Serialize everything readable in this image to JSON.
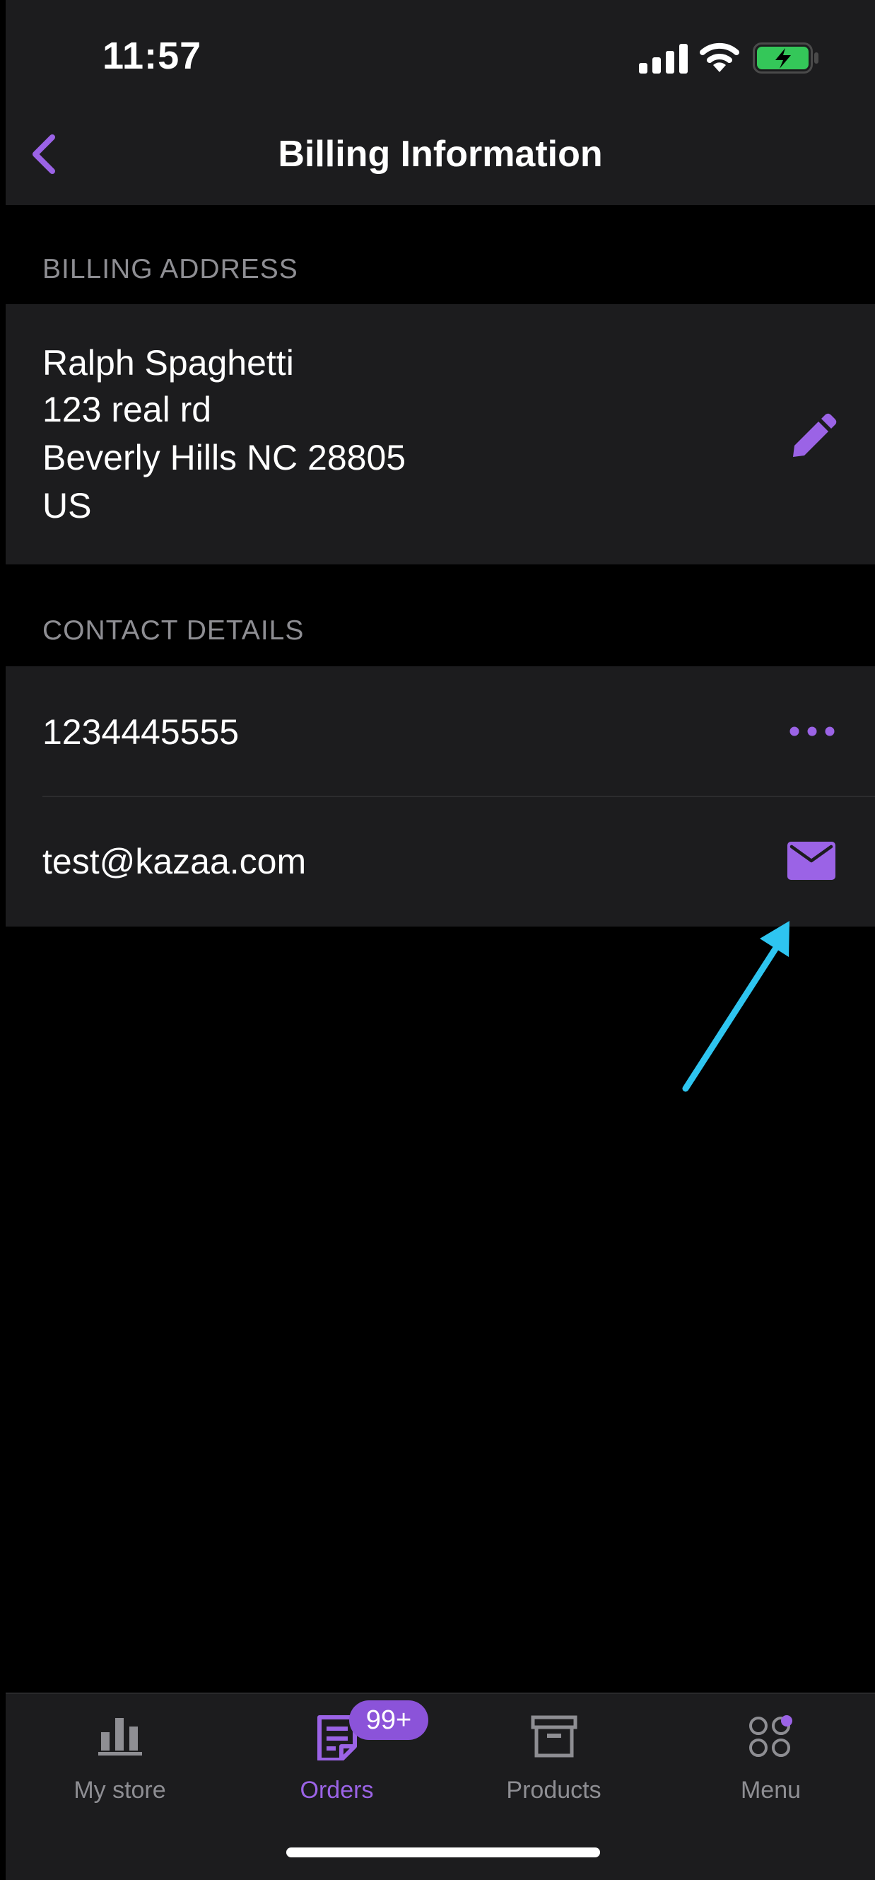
{
  "status_bar": {
    "time": "11:57"
  },
  "nav": {
    "title": "Billing Information",
    "back_icon": "chevron-left-icon"
  },
  "billing_address": {
    "header": "BILLING ADDRESS",
    "lines": [
      "Ralph Spaghetti",
      "123 real rd",
      "Beverly Hills NC 28805",
      "US"
    ],
    "action_icon": "pencil-icon"
  },
  "contact_details": {
    "header": "CONTACT DETAILS",
    "phone": "1234445555",
    "phone_icon": "more-dots-icon",
    "email": "test@kazaa.com",
    "email_icon": "envelope-icon"
  },
  "tabbar": {
    "tabs": [
      {
        "label": "My store",
        "icon": "bar-chart-icon",
        "active": false
      },
      {
        "label": "Orders",
        "icon": "orders-icon",
        "active": true
      },
      {
        "label": "Products",
        "icon": "archive-box-icon",
        "active": false
      },
      {
        "label": "Menu",
        "icon": "grid-circles-icon",
        "active": false
      }
    ],
    "orders_badge": "99+"
  },
  "colors": {
    "accent": "#9b63e6",
    "background": "#000000",
    "cell_background": "#1c1c1e",
    "secondary_text": "#8e8e93",
    "annotation_arrow": "#2ec5f0",
    "battery_green": "#34c759"
  }
}
